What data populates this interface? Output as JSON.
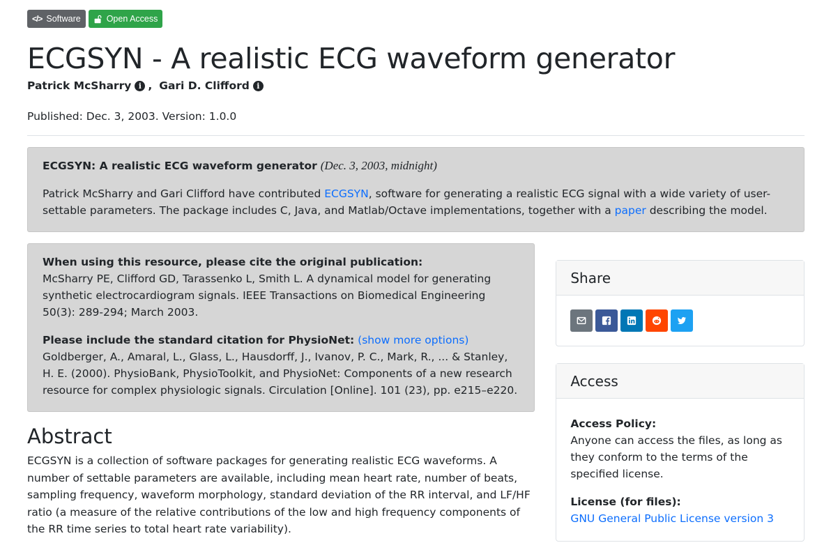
{
  "badges": {
    "software_label": "Software",
    "open_access_label": "Open Access",
    "software_icon": "code-icon",
    "open_access_icon": "unlock-icon"
  },
  "title": "ECGSYN - A realistic ECG waveform generator",
  "authors": [
    {
      "name": "Patrick McSharry",
      "icon": "info-icon"
    },
    {
      "name": "Gari D. Clifford",
      "icon": "info-icon"
    }
  ],
  "author_separator": ",",
  "published": "Published: Dec. 3, 2003. Version: 1.0.0",
  "news": {
    "heading": "ECGSYN: A realistic ECG waveform generator",
    "date": "(Dec. 3, 2003, midnight)",
    "text_1": "Patrick McSharry and Gari Clifford have contributed ",
    "link_1": "ECGSYN",
    "text_2": ", software for generating a realistic ECG signal with a wide variety of user-settable parameters. The package includes C, Java, and Matlab/Octave implementations, together with a ",
    "link_2": "paper",
    "text_3": " describing the model."
  },
  "citation": {
    "original_heading": "When using this resource, please cite the original publication:",
    "original_text": "McSharry PE, Clifford GD, Tarassenko L, Smith L. A dynamical model for generating synthetic electrocardiogram signals. IEEE Transactions on Biomedical Engineering 50(3): 289-294; March 2003.",
    "standard_heading": "Please include the standard citation for PhysioNet:",
    "show_more": "(show more options)",
    "standard_text": "Goldberger, A., Amaral, L., Glass, L., Hausdorff, J., Ivanov, P. C., Mark, R., ... & Stanley, H. E. (2000). PhysioBank, PhysioToolkit, and PhysioNet: Components of a new research resource for complex physiologic signals. Circulation [Online]. 101 (23), pp. e215–e220."
  },
  "abstract": {
    "heading": "Abstract",
    "text": "ECGSYN is a collection of software packages for generating realistic ECG waveforms. A number of settable parameters are available, including mean heart rate, number of beats, sampling frequency, waveform morphology, standard deviation of the RR interval, and LF/HF ratio (a measure of the relative contributions of the low and high frequency components of the RR time series to total heart rate variability)."
  },
  "share": {
    "heading": "Share",
    "buttons": [
      {
        "icon": "email-icon",
        "color": "#6c757d"
      },
      {
        "icon": "facebook-icon",
        "color": "#3b5998"
      },
      {
        "icon": "linkedin-icon",
        "color": "#0077b5"
      },
      {
        "icon": "reddit-icon",
        "color": "#ff4500"
      },
      {
        "icon": "twitter-icon",
        "color": "#1da1f2"
      }
    ]
  },
  "access": {
    "heading": "Access",
    "policy_label": "Access Policy:",
    "policy_text": "Anyone can access the files, as long as they conform to the terms of the specified license.",
    "license_label": "License (for files):",
    "license_link": "GNU General Public License version 3"
  },
  "colors": {
    "link": "#0d6efd",
    "badge_software": "#5f6266",
    "badge_open_access": "#2fa449",
    "panel_bg": "#d6d6d6"
  }
}
